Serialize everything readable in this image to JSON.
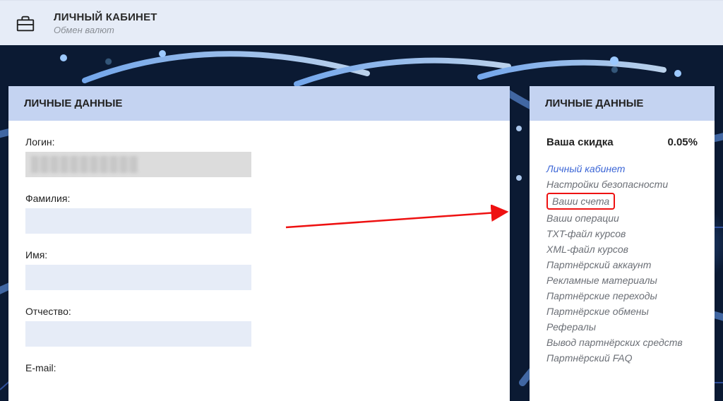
{
  "header": {
    "title": "ЛИЧНЫЙ КАБИНЕТ",
    "subtitle": "Обмен валют",
    "logo_icon": "briefcase-icon"
  },
  "left_panel": {
    "heading": "ЛИЧНЫЕ ДАННЫЕ",
    "fields": {
      "login_label": "Логин:",
      "lastname_label": "Фамилия:",
      "firstname_label": "Имя:",
      "patronymic_label": "Отчество:",
      "email_label": "E-mail:"
    }
  },
  "right_panel": {
    "heading": "ЛИЧНЫЕ ДАННЫЕ",
    "discount_label": "Ваша скидка",
    "discount_value": "0.05%",
    "nav": [
      "Личный кабинет",
      "Настройки безопасности",
      "Ваши счета",
      "Ваши операции",
      "TXT-файл курсов",
      "XML-файл курсов",
      "Партнёрский аккаунт",
      "Рекламные материалы",
      "Партнёрские переходы",
      "Партнёрские обмены",
      "Рефералы",
      "Вывод партнёрских средств",
      "Партнёрский FAQ"
    ],
    "active_index": 0,
    "highlighted_index": 2
  }
}
